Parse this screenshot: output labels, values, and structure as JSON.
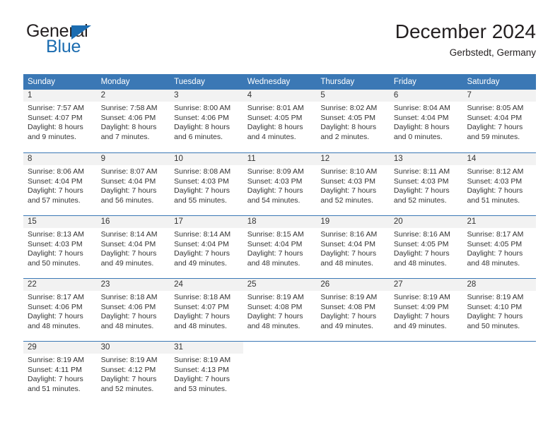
{
  "brand": {
    "name_top": "General",
    "name_bottom": "Blue",
    "accent_color": "#1b6cb0"
  },
  "header": {
    "title": "December 2024",
    "subtitle": "Gerbstedt, Germany"
  },
  "theme": {
    "header_bg": "#3b78b5",
    "day_band_bg": "#f2f2f2",
    "text_color": "#333333"
  },
  "calendar": {
    "weekdays": [
      "Sunday",
      "Monday",
      "Tuesday",
      "Wednesday",
      "Thursday",
      "Friday",
      "Saturday"
    ],
    "weeks": [
      [
        {
          "day": "1",
          "sunrise": "Sunrise: 7:57 AM",
          "sunset": "Sunset: 4:07 PM",
          "daylight_1": "Daylight: 8 hours",
          "daylight_2": "and 9 minutes."
        },
        {
          "day": "2",
          "sunrise": "Sunrise: 7:58 AM",
          "sunset": "Sunset: 4:06 PM",
          "daylight_1": "Daylight: 8 hours",
          "daylight_2": "and 7 minutes."
        },
        {
          "day": "3",
          "sunrise": "Sunrise: 8:00 AM",
          "sunset": "Sunset: 4:06 PM",
          "daylight_1": "Daylight: 8 hours",
          "daylight_2": "and 6 minutes."
        },
        {
          "day": "4",
          "sunrise": "Sunrise: 8:01 AM",
          "sunset": "Sunset: 4:05 PM",
          "daylight_1": "Daylight: 8 hours",
          "daylight_2": "and 4 minutes."
        },
        {
          "day": "5",
          "sunrise": "Sunrise: 8:02 AM",
          "sunset": "Sunset: 4:05 PM",
          "daylight_1": "Daylight: 8 hours",
          "daylight_2": "and 2 minutes."
        },
        {
          "day": "6",
          "sunrise": "Sunrise: 8:04 AM",
          "sunset": "Sunset: 4:04 PM",
          "daylight_1": "Daylight: 8 hours",
          "daylight_2": "and 0 minutes."
        },
        {
          "day": "7",
          "sunrise": "Sunrise: 8:05 AM",
          "sunset": "Sunset: 4:04 PM",
          "daylight_1": "Daylight: 7 hours",
          "daylight_2": "and 59 minutes."
        }
      ],
      [
        {
          "day": "8",
          "sunrise": "Sunrise: 8:06 AM",
          "sunset": "Sunset: 4:04 PM",
          "daylight_1": "Daylight: 7 hours",
          "daylight_2": "and 57 minutes."
        },
        {
          "day": "9",
          "sunrise": "Sunrise: 8:07 AM",
          "sunset": "Sunset: 4:04 PM",
          "daylight_1": "Daylight: 7 hours",
          "daylight_2": "and 56 minutes."
        },
        {
          "day": "10",
          "sunrise": "Sunrise: 8:08 AM",
          "sunset": "Sunset: 4:03 PM",
          "daylight_1": "Daylight: 7 hours",
          "daylight_2": "and 55 minutes."
        },
        {
          "day": "11",
          "sunrise": "Sunrise: 8:09 AM",
          "sunset": "Sunset: 4:03 PM",
          "daylight_1": "Daylight: 7 hours",
          "daylight_2": "and 54 minutes."
        },
        {
          "day": "12",
          "sunrise": "Sunrise: 8:10 AM",
          "sunset": "Sunset: 4:03 PM",
          "daylight_1": "Daylight: 7 hours",
          "daylight_2": "and 52 minutes."
        },
        {
          "day": "13",
          "sunrise": "Sunrise: 8:11 AM",
          "sunset": "Sunset: 4:03 PM",
          "daylight_1": "Daylight: 7 hours",
          "daylight_2": "and 52 minutes."
        },
        {
          "day": "14",
          "sunrise": "Sunrise: 8:12 AM",
          "sunset": "Sunset: 4:03 PM",
          "daylight_1": "Daylight: 7 hours",
          "daylight_2": "and 51 minutes."
        }
      ],
      [
        {
          "day": "15",
          "sunrise": "Sunrise: 8:13 AM",
          "sunset": "Sunset: 4:03 PM",
          "daylight_1": "Daylight: 7 hours",
          "daylight_2": "and 50 minutes."
        },
        {
          "day": "16",
          "sunrise": "Sunrise: 8:14 AM",
          "sunset": "Sunset: 4:04 PM",
          "daylight_1": "Daylight: 7 hours",
          "daylight_2": "and 49 minutes."
        },
        {
          "day": "17",
          "sunrise": "Sunrise: 8:14 AM",
          "sunset": "Sunset: 4:04 PM",
          "daylight_1": "Daylight: 7 hours",
          "daylight_2": "and 49 minutes."
        },
        {
          "day": "18",
          "sunrise": "Sunrise: 8:15 AM",
          "sunset": "Sunset: 4:04 PM",
          "daylight_1": "Daylight: 7 hours",
          "daylight_2": "and 48 minutes."
        },
        {
          "day": "19",
          "sunrise": "Sunrise: 8:16 AM",
          "sunset": "Sunset: 4:04 PM",
          "daylight_1": "Daylight: 7 hours",
          "daylight_2": "and 48 minutes."
        },
        {
          "day": "20",
          "sunrise": "Sunrise: 8:16 AM",
          "sunset": "Sunset: 4:05 PM",
          "daylight_1": "Daylight: 7 hours",
          "daylight_2": "and 48 minutes."
        },
        {
          "day": "21",
          "sunrise": "Sunrise: 8:17 AM",
          "sunset": "Sunset: 4:05 PM",
          "daylight_1": "Daylight: 7 hours",
          "daylight_2": "and 48 minutes."
        }
      ],
      [
        {
          "day": "22",
          "sunrise": "Sunrise: 8:17 AM",
          "sunset": "Sunset: 4:06 PM",
          "daylight_1": "Daylight: 7 hours",
          "daylight_2": "and 48 minutes."
        },
        {
          "day": "23",
          "sunrise": "Sunrise: 8:18 AM",
          "sunset": "Sunset: 4:06 PM",
          "daylight_1": "Daylight: 7 hours",
          "daylight_2": "and 48 minutes."
        },
        {
          "day": "24",
          "sunrise": "Sunrise: 8:18 AM",
          "sunset": "Sunset: 4:07 PM",
          "daylight_1": "Daylight: 7 hours",
          "daylight_2": "and 48 minutes."
        },
        {
          "day": "25",
          "sunrise": "Sunrise: 8:19 AM",
          "sunset": "Sunset: 4:08 PM",
          "daylight_1": "Daylight: 7 hours",
          "daylight_2": "and 48 minutes."
        },
        {
          "day": "26",
          "sunrise": "Sunrise: 8:19 AM",
          "sunset": "Sunset: 4:08 PM",
          "daylight_1": "Daylight: 7 hours",
          "daylight_2": "and 49 minutes."
        },
        {
          "day": "27",
          "sunrise": "Sunrise: 8:19 AM",
          "sunset": "Sunset: 4:09 PM",
          "daylight_1": "Daylight: 7 hours",
          "daylight_2": "and 49 minutes."
        },
        {
          "day": "28",
          "sunrise": "Sunrise: 8:19 AM",
          "sunset": "Sunset: 4:10 PM",
          "daylight_1": "Daylight: 7 hours",
          "daylight_2": "and 50 minutes."
        }
      ],
      [
        {
          "day": "29",
          "sunrise": "Sunrise: 8:19 AM",
          "sunset": "Sunset: 4:11 PM",
          "daylight_1": "Daylight: 7 hours",
          "daylight_2": "and 51 minutes."
        },
        {
          "day": "30",
          "sunrise": "Sunrise: 8:19 AM",
          "sunset": "Sunset: 4:12 PM",
          "daylight_1": "Daylight: 7 hours",
          "daylight_2": "and 52 minutes."
        },
        {
          "day": "31",
          "sunrise": "Sunrise: 8:19 AM",
          "sunset": "Sunset: 4:13 PM",
          "daylight_1": "Daylight: 7 hours",
          "daylight_2": "and 53 minutes."
        },
        {
          "day": "",
          "sunrise": "",
          "sunset": "",
          "daylight_1": "",
          "daylight_2": ""
        },
        {
          "day": "",
          "sunrise": "",
          "sunset": "",
          "daylight_1": "",
          "daylight_2": ""
        },
        {
          "day": "",
          "sunrise": "",
          "sunset": "",
          "daylight_1": "",
          "daylight_2": ""
        },
        {
          "day": "",
          "sunrise": "",
          "sunset": "",
          "daylight_1": "",
          "daylight_2": ""
        }
      ]
    ]
  }
}
